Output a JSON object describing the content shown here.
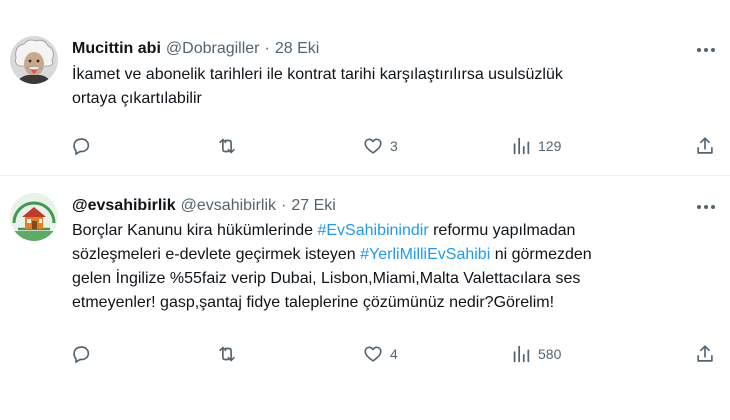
{
  "tweets": [
    {
      "display_name": "Mucittin abi",
      "handle": "@Dobragiller",
      "separator": "·",
      "time": "28 Eki",
      "avatar_icon": "einstein-avatar-icon",
      "lines": [
        [
          {
            "text": "İkamet ve abonelik tarihleri ile kontrat tarihi karşılaştırılırsa usulsüzlük",
            "hashtag": false
          }
        ],
        [
          {
            "text": "ortaya çıkartılabilir",
            "hashtag": false
          }
        ]
      ],
      "actions": {
        "replies": "",
        "retweets": "",
        "likes": "3",
        "views": "129"
      }
    },
    {
      "display_name": "@evsahibirlik",
      "handle": "@evsahibirlik",
      "separator": "·",
      "time": "27 Eki",
      "avatar_icon": "house-logo-avatar-icon",
      "lines": [
        [
          {
            "text": "Borçlar Kanunu kira hükümlerinde ",
            "hashtag": false
          },
          {
            "text": "#EvSahibinindir",
            "hashtag": true
          },
          {
            "text": " reformu yapılmadan",
            "hashtag": false
          }
        ],
        [
          {
            "text": "sözleşmeleri e-devlete geçirmek isteyen ",
            "hashtag": false
          },
          {
            "text": "#YerliMilliEvSahibi",
            "hashtag": true
          },
          {
            "text": " ni görmezden",
            "hashtag": false
          }
        ],
        [
          {
            "text": "gelen İngilize %55faiz verip Dubai, Lisbon,Miami,Malta Valettacılara ses",
            "hashtag": false
          }
        ],
        [
          {
            "text": "etmeyenler! gasp,şantaj fidye taleplerine çözümünüz nedir?Görelim!",
            "hashtag": false
          }
        ]
      ],
      "actions": {
        "replies": "",
        "retweets": "",
        "likes": "4",
        "views": "580"
      }
    }
  ],
  "colors": {
    "text": "#0f1419",
    "secondary": "#536471",
    "hashtag": "#1d9bf0",
    "divider": "#eff3f4"
  }
}
